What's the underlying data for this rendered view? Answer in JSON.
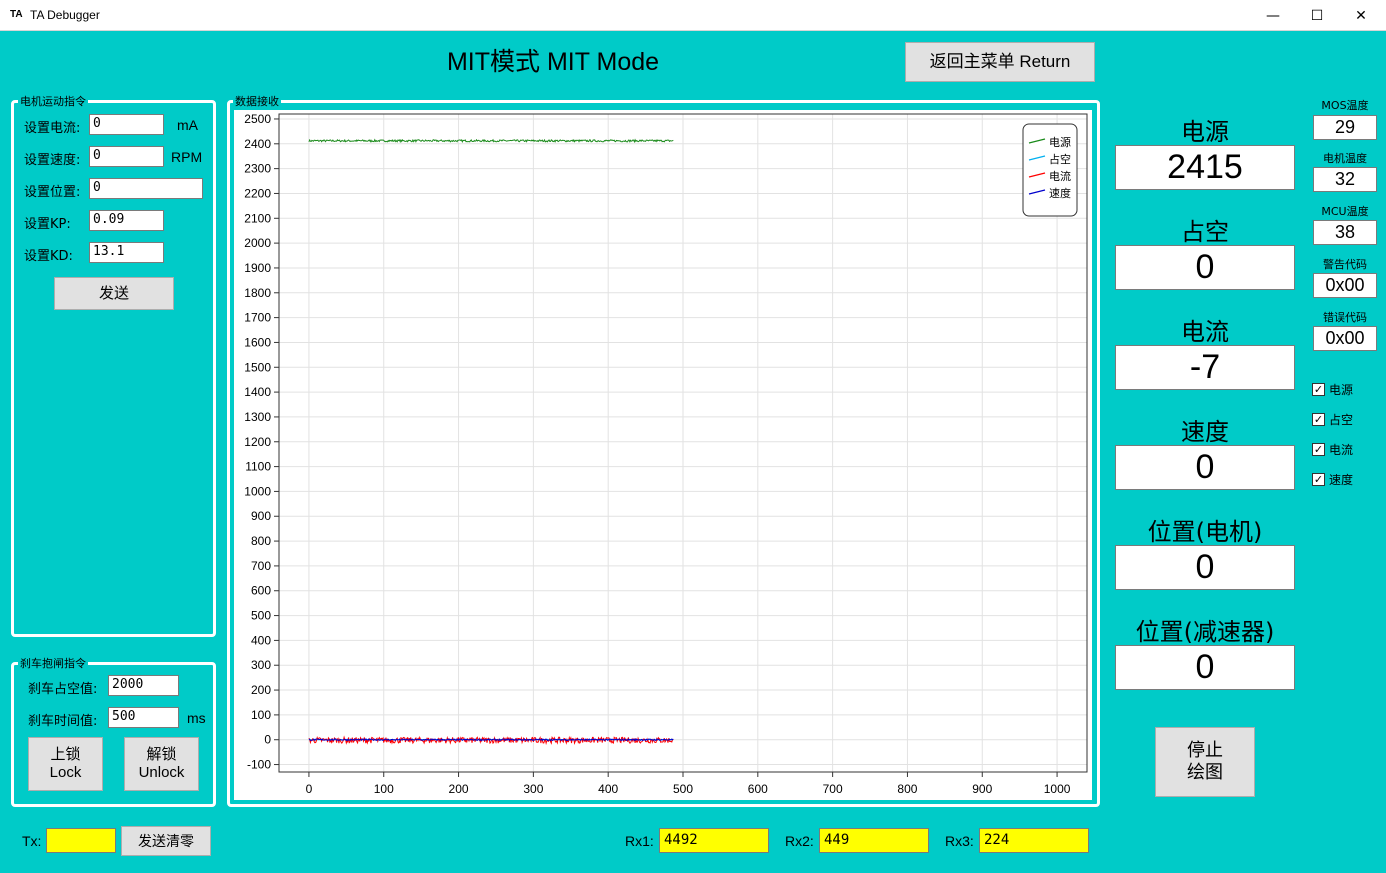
{
  "window": {
    "logo": "TA",
    "title": "TA Debugger",
    "minimize": "—",
    "maximize": "☐",
    "close": "✕"
  },
  "header": {
    "title": "MIT模式 MIT Mode",
    "return_button": "返回主菜单 Return"
  },
  "motion": {
    "group_label": "电机运动指令",
    "current_label": "设置电流:",
    "current_value": "0",
    "current_unit": "mA",
    "speed_label": "设置速度:",
    "speed_value": "0",
    "speed_unit": "RPM",
    "position_label": "设置位置:",
    "position_value": "0",
    "kp_label": "设置KP:",
    "kp_value": "0.09",
    "kd_label": "设置KD:",
    "kd_value": "13.1",
    "send_button": "发送"
  },
  "brake": {
    "group_label": "刹车抱闸指令",
    "duty_label": "刹车占空值:",
    "duty_value": "2000",
    "time_label": "刹车时间值:",
    "time_value": "500",
    "time_unit": "ms",
    "lock_button_line1": "上锁",
    "lock_button_line2": "Lock",
    "unlock_button_line1": "解锁",
    "unlock_button_line2": "Unlock"
  },
  "plot_group_label": "数据接收",
  "chart_data": {
    "type": "line",
    "xlim": [
      -40,
      1040
    ],
    "ylim": [
      -130,
      2520
    ],
    "x_ticks": [
      0,
      100,
      200,
      300,
      400,
      500,
      600,
      700,
      800,
      900,
      1000
    ],
    "y_ticks": [
      -100,
      0,
      100,
      200,
      300,
      400,
      500,
      600,
      700,
      800,
      900,
      1000,
      1100,
      1200,
      1300,
      1400,
      1500,
      1600,
      1700,
      1800,
      1900,
      2000,
      2100,
      2200,
      2300,
      2400,
      2500
    ],
    "grid": true,
    "legend_position": "top-right",
    "series": [
      {
        "name": "电源",
        "color": "#1a8a1a",
        "x_range": [
          0,
          487
        ],
        "approx_value": 2412,
        "noise": 4
      },
      {
        "name": "占空",
        "color": "#00b0f0",
        "x_range": [
          0,
          487
        ],
        "approx_value": 0,
        "noise": 1
      },
      {
        "name": "电流",
        "color": "#ff0000",
        "x_range": [
          0,
          487
        ],
        "approx_value": -2,
        "noise": 12
      },
      {
        "name": "速度",
        "color": "#0000cc",
        "x_range": [
          0,
          487
        ],
        "approx_value": 0,
        "noise": 3
      }
    ]
  },
  "readouts": {
    "power_label": "电源",
    "power_value": "2415",
    "duty_label": "占空",
    "duty_value": "0",
    "current_label": "电流",
    "current_value": "-7",
    "speed_label": "速度",
    "speed_value": "0",
    "pos_motor_label": "位置(电机)",
    "pos_motor_value": "0",
    "pos_gear_label": "位置(减速器)",
    "pos_gear_value": "0"
  },
  "temps": {
    "mos_label": "MOS温度",
    "mos_value": "29",
    "motor_label": "电机温度",
    "motor_value": "32",
    "mcu_label": "MCU温度",
    "mcu_value": "38",
    "warn_label": "警告代码",
    "warn_value": "0x00",
    "err_label": "错误代码",
    "err_value": "0x00"
  },
  "checkboxes": {
    "power": "电源",
    "duty": "占空",
    "current": "电流",
    "speed": "速度",
    "check_mark": "✓"
  },
  "stop_plot_line1": "停止",
  "stop_plot_line2": "绘图",
  "status": {
    "tx_label": "Tx:",
    "tx_value": "",
    "clear_button": "发送清零",
    "rx1_label": "Rx1:",
    "rx1_value": "4492",
    "rx2_label": "Rx2:",
    "rx2_value": "449",
    "rx3_label": "Rx3:",
    "rx3_value": "224"
  }
}
